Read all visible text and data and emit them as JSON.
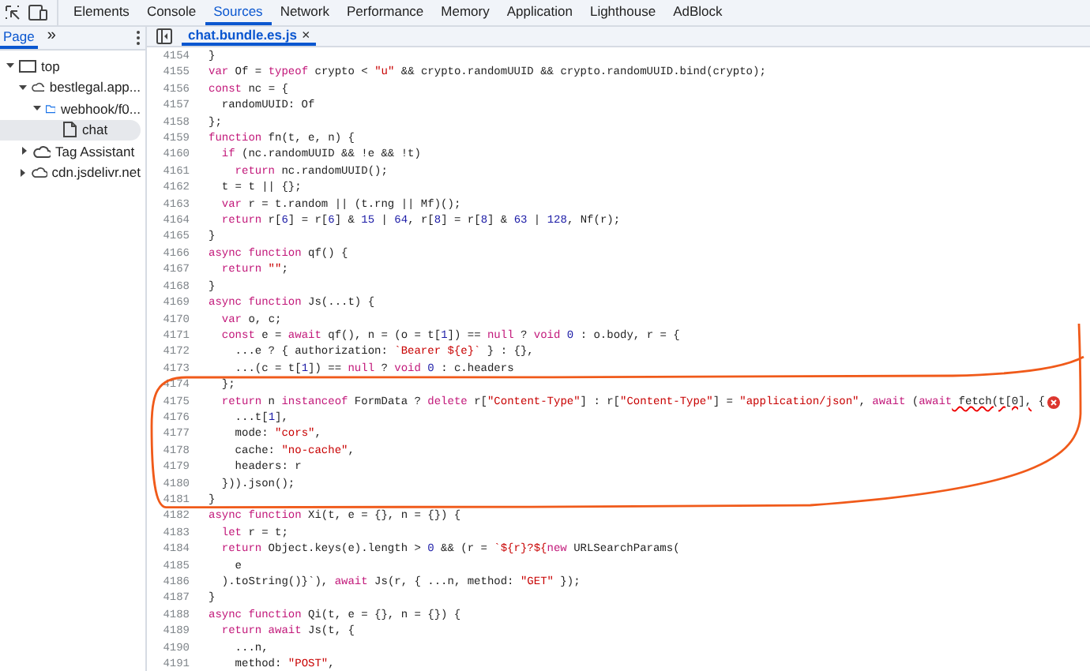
{
  "toolbar": {
    "tabs": [
      {
        "label": "Elements",
        "selected": false
      },
      {
        "label": "Console",
        "selected": false
      },
      {
        "label": "Sources",
        "selected": true
      },
      {
        "label": "Network",
        "selected": false
      },
      {
        "label": "Performance",
        "selected": false
      },
      {
        "label": "Memory",
        "selected": false
      },
      {
        "label": "Application",
        "selected": false
      },
      {
        "label": "Lighthouse",
        "selected": false
      },
      {
        "label": "AdBlock",
        "selected": false
      }
    ]
  },
  "sidebar": {
    "tabs": [
      {
        "label": "Page",
        "selected": true
      }
    ],
    "more": "»",
    "tree": [
      {
        "label": "top",
        "kind": "frame",
        "expanded": true,
        "selected": false,
        "children": [
          {
            "label": "bestlegal.app...",
            "kind": "origin",
            "expanded": true,
            "selected": false,
            "children": [
              {
                "label": "webhook/f0...",
                "kind": "folder",
                "expanded": true,
                "selected": false,
                "children": [
                  {
                    "label": "chat",
                    "kind": "file",
                    "expanded": false,
                    "selected": true
                  }
                ]
              }
            ]
          },
          {
            "label": "Tag Assistant",
            "kind": "origin",
            "expanded": false,
            "selected": false
          },
          {
            "label": "cdn.jsdelivr.net",
            "kind": "origin",
            "expanded": false,
            "selected": false
          }
        ]
      }
    ]
  },
  "editor": {
    "file_tab": {
      "label": "chat.bundle.es.js",
      "close": "×",
      "selected": true
    },
    "lines": [
      {
        "number": "4154",
        "tokens": [
          {
            "kind": "plain",
            "text": "}"
          }
        ]
      },
      {
        "number": "4155",
        "tokens": [
          {
            "kind": "keyword",
            "text": "var"
          },
          {
            "kind": "plain",
            "text": " Of = "
          },
          {
            "kind": "keyword",
            "text": "typeof"
          },
          {
            "kind": "plain",
            "text": " crypto < "
          },
          {
            "kind": "string",
            "text": "\"u\""
          },
          {
            "kind": "plain",
            "text": " && crypto.randomUUID && crypto.randomUUID.bind(crypto);"
          }
        ]
      },
      {
        "number": "4156",
        "tokens": [
          {
            "kind": "keyword",
            "text": "const"
          },
          {
            "kind": "plain",
            "text": " nc = {"
          }
        ]
      },
      {
        "number": "4157",
        "tokens": [
          {
            "kind": "plain",
            "text": "  randomUUID: Of"
          }
        ]
      },
      {
        "number": "4158",
        "tokens": [
          {
            "kind": "plain",
            "text": "};"
          }
        ]
      },
      {
        "number": "4159",
        "tokens": [
          {
            "kind": "keyword",
            "text": "function"
          },
          {
            "kind": "plain",
            "text": " fn(t, e, n) {"
          }
        ]
      },
      {
        "number": "4160",
        "tokens": [
          {
            "kind": "keyword",
            "text": "  if"
          },
          {
            "kind": "plain",
            "text": " (nc.randomUUID && !e && !t)"
          }
        ]
      },
      {
        "number": "4161",
        "tokens": [
          {
            "kind": "keyword",
            "text": "    return"
          },
          {
            "kind": "plain",
            "text": " nc.randomUUID();"
          }
        ]
      },
      {
        "number": "4162",
        "tokens": [
          {
            "kind": "plain",
            "text": "  t = t || {};"
          }
        ]
      },
      {
        "number": "4163",
        "tokens": [
          {
            "kind": "keyword",
            "text": "  var"
          },
          {
            "kind": "plain",
            "text": " r = t.random || (t.rng || Mf)();"
          }
        ]
      },
      {
        "number": "4164",
        "tokens": [
          {
            "kind": "keyword",
            "text": "  return"
          },
          {
            "kind": "plain",
            "text": " r["
          },
          {
            "kind": "number",
            "text": "6"
          },
          {
            "kind": "plain",
            "text": "] = r["
          },
          {
            "kind": "number",
            "text": "6"
          },
          {
            "kind": "plain",
            "text": "] & "
          },
          {
            "kind": "number",
            "text": "15"
          },
          {
            "kind": "plain",
            "text": " | "
          },
          {
            "kind": "number",
            "text": "64"
          },
          {
            "kind": "plain",
            "text": ", r["
          },
          {
            "kind": "number",
            "text": "8"
          },
          {
            "kind": "plain",
            "text": "] = r["
          },
          {
            "kind": "number",
            "text": "8"
          },
          {
            "kind": "plain",
            "text": "] & "
          },
          {
            "kind": "number",
            "text": "63"
          },
          {
            "kind": "plain",
            "text": " | "
          },
          {
            "kind": "number",
            "text": "128"
          },
          {
            "kind": "plain",
            "text": ", Nf(r);"
          }
        ]
      },
      {
        "number": "4165",
        "tokens": [
          {
            "kind": "plain",
            "text": "}"
          }
        ]
      },
      {
        "number": "4166",
        "tokens": [
          {
            "kind": "keyword",
            "text": "async function"
          },
          {
            "kind": "plain",
            "text": " qf() {"
          }
        ]
      },
      {
        "number": "4167",
        "tokens": [
          {
            "kind": "keyword",
            "text": "  return"
          },
          {
            "kind": "string",
            "text": " \"\""
          },
          {
            "kind": "plain",
            "text": ";"
          }
        ]
      },
      {
        "number": "4168",
        "tokens": [
          {
            "kind": "plain",
            "text": "}"
          }
        ]
      },
      {
        "number": "4169",
        "tokens": [
          {
            "kind": "keyword",
            "text": "async function"
          },
          {
            "kind": "plain",
            "text": " Js(...t) {"
          }
        ]
      },
      {
        "number": "4170",
        "tokens": [
          {
            "kind": "keyword",
            "text": "  var"
          },
          {
            "kind": "plain",
            "text": " o, c;"
          }
        ]
      },
      {
        "number": "4171",
        "tokens": [
          {
            "kind": "keyword",
            "text": "  const"
          },
          {
            "kind": "plain",
            "text": " e = "
          },
          {
            "kind": "keyword",
            "text": "await"
          },
          {
            "kind": "plain",
            "text": " qf(), n = (o = t["
          },
          {
            "kind": "number",
            "text": "1"
          },
          {
            "kind": "plain",
            "text": "]) == "
          },
          {
            "kind": "keyword",
            "text": "null"
          },
          {
            "kind": "plain",
            "text": " ? "
          },
          {
            "kind": "keyword",
            "text": "void"
          },
          {
            "kind": "number",
            "text": " 0"
          },
          {
            "kind": "plain",
            "text": " : o.body, r = {"
          }
        ]
      },
      {
        "number": "4172",
        "tokens": [
          {
            "kind": "plain",
            "text": "    ...e ? { authorization: "
          },
          {
            "kind": "string",
            "text": "`Bearer ${e}`"
          },
          {
            "kind": "plain",
            "text": " } : {},"
          }
        ]
      },
      {
        "number": "4173",
        "tokens": [
          {
            "kind": "plain",
            "text": "    ...(c = t["
          },
          {
            "kind": "number",
            "text": "1"
          },
          {
            "kind": "plain",
            "text": "]) == "
          },
          {
            "kind": "keyword",
            "text": "null"
          },
          {
            "kind": "plain",
            "text": " ? "
          },
          {
            "kind": "keyword",
            "text": "void"
          },
          {
            "kind": "number",
            "text": " 0"
          },
          {
            "kind": "plain",
            "text": " : c.headers"
          }
        ]
      },
      {
        "number": "4174",
        "tokens": [
          {
            "kind": "plain",
            "text": "  };"
          }
        ]
      },
      {
        "number": "4175",
        "error": true,
        "tokens": [
          {
            "kind": "keyword",
            "text": "  return"
          },
          {
            "kind": "plain",
            "text": " n "
          },
          {
            "kind": "keyword",
            "text": "instanceof"
          },
          {
            "kind": "plain",
            "text": " FormData ? "
          },
          {
            "kind": "keyword",
            "text": "delete"
          },
          {
            "kind": "plain",
            "text": " r["
          },
          {
            "kind": "string",
            "text": "\"Content-Type\""
          },
          {
            "kind": "plain",
            "text": "] : r["
          },
          {
            "kind": "string",
            "text": "\"Content-Type\""
          },
          {
            "kind": "plain",
            "text": "] = "
          },
          {
            "kind": "string",
            "text": "\"application/json\""
          },
          {
            "kind": "plain",
            "text": ", "
          },
          {
            "kind": "keyword",
            "text": "await"
          },
          {
            "kind": "plain",
            "text": " ("
          },
          {
            "kind": "keyword",
            "text": "await"
          },
          {
            "kind": "error",
            "text": " fetch(t[0],"
          },
          {
            "kind": "plain",
            "text": " {"
          }
        ]
      },
      {
        "number": "4176",
        "tokens": [
          {
            "kind": "plain",
            "text": "    ...t["
          },
          {
            "kind": "number",
            "text": "1"
          },
          {
            "kind": "plain",
            "text": "],"
          }
        ]
      },
      {
        "number": "4177",
        "tokens": [
          {
            "kind": "plain",
            "text": "    mode: "
          },
          {
            "kind": "string",
            "text": "\"cors\""
          },
          {
            "kind": "plain",
            "text": ","
          }
        ]
      },
      {
        "number": "4178",
        "tokens": [
          {
            "kind": "plain",
            "text": "    cache: "
          },
          {
            "kind": "string",
            "text": "\"no-cache\""
          },
          {
            "kind": "plain",
            "text": ","
          }
        ]
      },
      {
        "number": "4179",
        "tokens": [
          {
            "kind": "plain",
            "text": "    headers: r"
          }
        ]
      },
      {
        "number": "4180",
        "tokens": [
          {
            "kind": "plain",
            "text": "  })).json();"
          }
        ]
      },
      {
        "number": "4181",
        "tokens": [
          {
            "kind": "plain",
            "text": "}"
          }
        ]
      },
      {
        "number": "4182",
        "tokens": [
          {
            "kind": "keyword",
            "text": "async function"
          },
          {
            "kind": "plain",
            "text": " Xi(t, e = {}, n = {}) {"
          }
        ]
      },
      {
        "number": "4183",
        "tokens": [
          {
            "kind": "keyword",
            "text": "  let"
          },
          {
            "kind": "plain",
            "text": " r = t;"
          }
        ]
      },
      {
        "number": "4184",
        "tokens": [
          {
            "kind": "keyword",
            "text": "  return"
          },
          {
            "kind": "plain",
            "text": " Object.keys(e).length > "
          },
          {
            "kind": "number",
            "text": "0"
          },
          {
            "kind": "plain",
            "text": " && (r = "
          },
          {
            "kind": "string",
            "text": "`${r}?${"
          },
          {
            "kind": "keyword",
            "text": "new"
          },
          {
            "kind": "plain",
            "text": " URLSearchParams("
          }
        ]
      },
      {
        "number": "4185",
        "tokens": [
          {
            "kind": "plain",
            "text": "    e"
          }
        ]
      },
      {
        "number": "4186",
        "tokens": [
          {
            "kind": "plain",
            "text": "  ).toString()}`), "
          },
          {
            "kind": "keyword",
            "text": "await"
          },
          {
            "kind": "plain",
            "text": " Js(r, { ...n, method: "
          },
          {
            "kind": "string",
            "text": "\"GET\""
          },
          {
            "kind": "plain",
            "text": " });"
          }
        ]
      },
      {
        "number": "4187",
        "tokens": [
          {
            "kind": "plain",
            "text": "}"
          }
        ]
      },
      {
        "number": "4188",
        "tokens": [
          {
            "kind": "keyword",
            "text": "async function"
          },
          {
            "kind": "plain",
            "text": " Qi(t, e = {}, n = {}) {"
          }
        ]
      },
      {
        "number": "4189",
        "tokens": [
          {
            "kind": "keyword",
            "text": "  return await"
          },
          {
            "kind": "plain",
            "text": " Js(t, {"
          }
        ]
      },
      {
        "number": "4190",
        "tokens": [
          {
            "kind": "plain",
            "text": "    ...n,"
          }
        ]
      },
      {
        "number": "4191",
        "tokens": [
          {
            "kind": "plain",
            "text": "    method: "
          },
          {
            "kind": "string",
            "text": "\"POST\""
          },
          {
            "kind": "plain",
            "text": ","
          }
        ]
      }
    ]
  }
}
